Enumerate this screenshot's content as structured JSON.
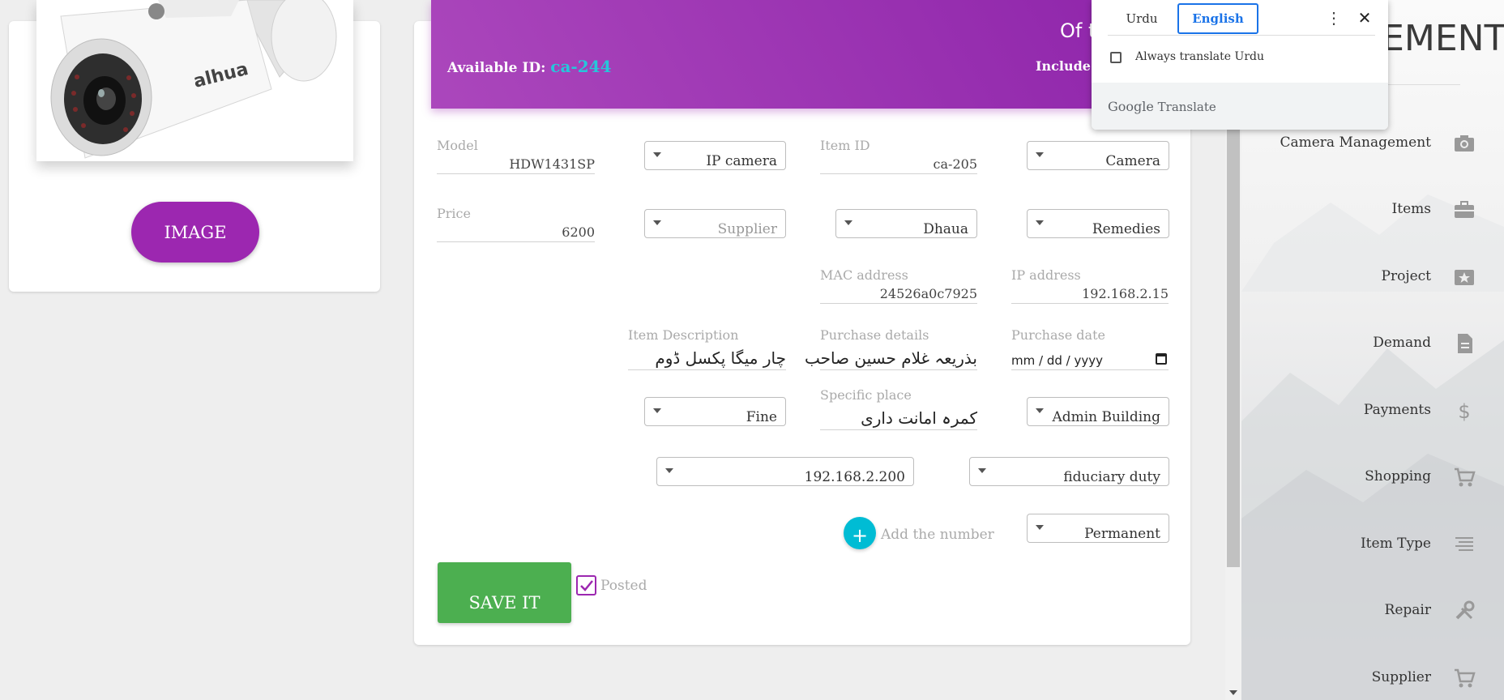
{
  "left_card": {
    "image_button": "IMAGE",
    "camera_brand_text": "alhua"
  },
  "header": {
    "available_label": "Available ID:",
    "available_id": "ca-244",
    "title_fragment": "Of t",
    "subtitle_fragment": "Include i"
  },
  "form": {
    "model": {
      "label": "Model",
      "value": "HDW1431SP"
    },
    "camera_kind": {
      "value": "IP camera"
    },
    "item_id": {
      "label": "Item ID",
      "value": "ca-205"
    },
    "category": {
      "value": "Camera"
    },
    "price": {
      "label": "Price",
      "value": "6200"
    },
    "supplier": {
      "placeholder": "Supplier"
    },
    "brand": {
      "value": "Dhaua"
    },
    "remedies": {
      "value": "Remedies"
    },
    "mac": {
      "label": "MAC address",
      "value": "24526a0c7925"
    },
    "ip": {
      "label": "IP address",
      "value": "192.168.2.15"
    },
    "item_description": {
      "label": "Item Description",
      "value": "چار میگا پکسل ڈوم"
    },
    "purchase_details": {
      "label": "Purchase details",
      "value": "بذریعہ غلام حسین صاحب"
    },
    "purchase_date": {
      "label": "Purchase date",
      "value": "mm / dd / yyyy"
    },
    "condition": {
      "value": "Fine"
    },
    "specific_place": {
      "label": "Specific place",
      "value": "کمرہ امانت داری"
    },
    "building": {
      "value": "Admin Building"
    },
    "nvr_ip": {
      "value": "192.168.2.200"
    },
    "duty": {
      "value": "fiduciary duty"
    },
    "add_number": {
      "icon": "+",
      "label": "Add the number"
    },
    "status": {
      "value": "Permanent"
    },
    "save_button": "SAVE IT",
    "posted": {
      "label": "Posted",
      "checked": true
    }
  },
  "sidebar": {
    "title_fragment": "GEMENT",
    "items": [
      {
        "label": "Camera Management",
        "icon": "camera-icon"
      },
      {
        "label": "Items",
        "icon": "briefcase-icon"
      },
      {
        "label": "Project",
        "icon": "star-card-icon"
      },
      {
        "label": "Demand",
        "icon": "document-icon"
      },
      {
        "label": "Payments",
        "icon": "dollar-icon"
      },
      {
        "label": "Shopping",
        "icon": "cart-icon"
      },
      {
        "label": "Item Type",
        "icon": "list-icon"
      },
      {
        "label": "Repair",
        "icon": "wrench-icon"
      },
      {
        "label": "Supplier",
        "icon": "cart-icon"
      }
    ]
  },
  "translate_popup": {
    "tab_source": "Urdu",
    "tab_target": "English",
    "always_translate": "Always translate Urdu",
    "brand_google": "Google",
    "brand_translate": "Translate",
    "more_icon": "⋮",
    "close_icon": "✕"
  },
  "colors": {
    "header_purple": "#9c27b0",
    "id_cyan": "#26c6da",
    "save_green": "#4caf50",
    "add_cyan": "#00bcd4",
    "translate_blue": "#1a73e8"
  }
}
